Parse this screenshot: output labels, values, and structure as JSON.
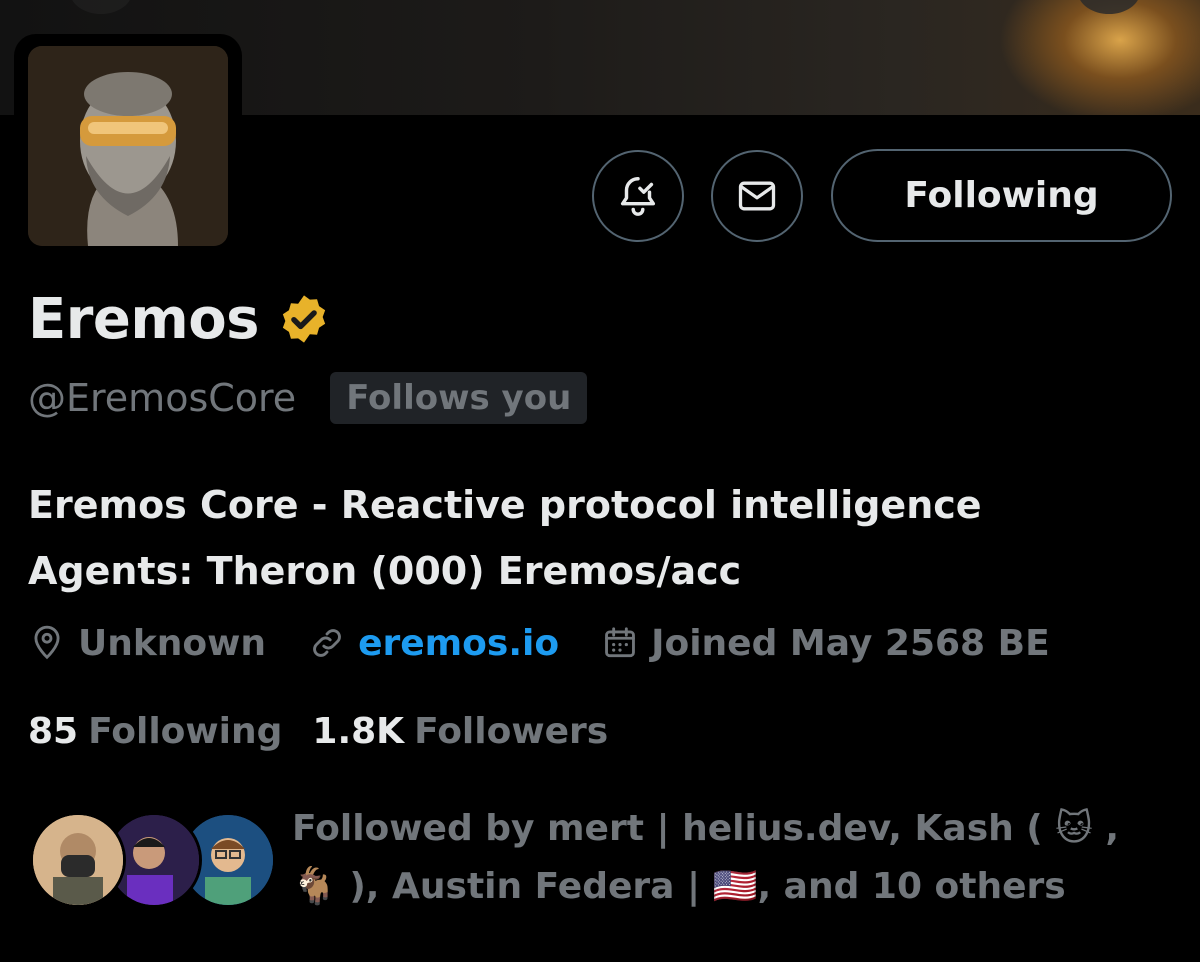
{
  "profile": {
    "display_name": "Eremos",
    "handle": "@EremosCore",
    "follows_you": "Follows you",
    "bio_line1": "Eremos Core - Reactive protocol intelligence",
    "bio_line2": "Agents: Theron (000) Eremos/acc",
    "location": "Unknown",
    "website": "eremos.io",
    "joined": "Joined May 2568 BE"
  },
  "actions": {
    "following_label": "Following",
    "notify_icon": "bell-check-icon",
    "message_icon": "envelope-icon"
  },
  "stats": {
    "following_count": "85",
    "following_label": "Following",
    "followers_count": "1.8K",
    "followers_label": "Followers"
  },
  "followed_by": {
    "line1": "Followed by mert | helius.dev, Kash ( 🐱 ,",
    "line2": "🐐 ), Austin Federa | 🇺🇸, and 10 others"
  },
  "colors": {
    "background": "#000000",
    "text_primary": "#e7e9ea",
    "text_secondary": "#71767b",
    "link": "#1d9bf0",
    "verified": "#e8b22a",
    "border": "#536471"
  }
}
